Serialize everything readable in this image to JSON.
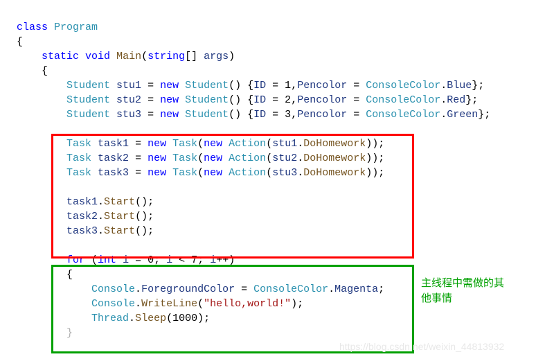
{
  "code": {
    "l1a": "class",
    "l1b": "Program",
    "l2": "{",
    "l3a": "static",
    "l3b": "void",
    "l3c": "Main",
    "l3d": "(",
    "l3e": "string",
    "l3f": "[] ",
    "l3g": "args",
    "l3h": ")",
    "l4": "{",
    "stu": {
      "type": "Student",
      "s1name": "stu1",
      "s2name": "stu2",
      "s3name": "stu3",
      "eq": " = ",
      "newkw": "new",
      "sp": " ",
      "ctor": "Student",
      "open": "() {",
      "idlab": "ID",
      "eqs": " = ",
      "id1": "1",
      "id2": "2",
      "id3": "3",
      "comma": ",",
      "penlab": "Pencolor",
      "cc": "ConsoleColor",
      "dot": ".",
      "c1": "Blue",
      "c2": "Red",
      "c3": "Green",
      "close": "};"
    },
    "task": {
      "type": "Task",
      "t1": "task1",
      "t2": "task2",
      "t3": "task3",
      "eq": " = ",
      "newkw": "new",
      "sp": " ",
      "ctor": "Task",
      "op": "(",
      "ctor2": "Action",
      "s1": "stu1",
      "s2": "stu2",
      "s3": "stu3",
      "dh": "DoHomework",
      "cl": "));"
    },
    "start": {
      "t1": "task1",
      "t2": "task2",
      "t3": "task3",
      "m": "Start",
      "c": "();"
    },
    "for": {
      "kw": "for",
      "op": " (",
      "intkw": "int",
      "sp": " ",
      "i": "i",
      "eq": " = ",
      "zero": "0",
      "sc": "; ",
      "lt": " < ",
      "seven": "7",
      "inc": "++",
      "cp": ")"
    },
    "fbopen": "{",
    "fg": {
      "cons": "Console",
      "dot": ".",
      "prop": "ForegroundColor",
      "eq": " = ",
      "cc": "ConsoleColor",
      "mag": "Magenta",
      "end": ";"
    },
    "wl": {
      "cons": "Console",
      "dot": ".",
      "m": "WriteLine",
      "op": "(",
      "str": "\"hello,world!\"",
      "cp": ");"
    },
    "th": {
      "t": "Thread",
      "dot": ".",
      "m": "Sleep",
      "op": "(",
      "n": "1000",
      "cp": ");"
    },
    "fbclose": "}"
  },
  "annotation": {
    "line1": "主线程中需做的其",
    "line2": "他事情"
  },
  "watermark": "https://blog.csdn.net/weixin_44813932"
}
